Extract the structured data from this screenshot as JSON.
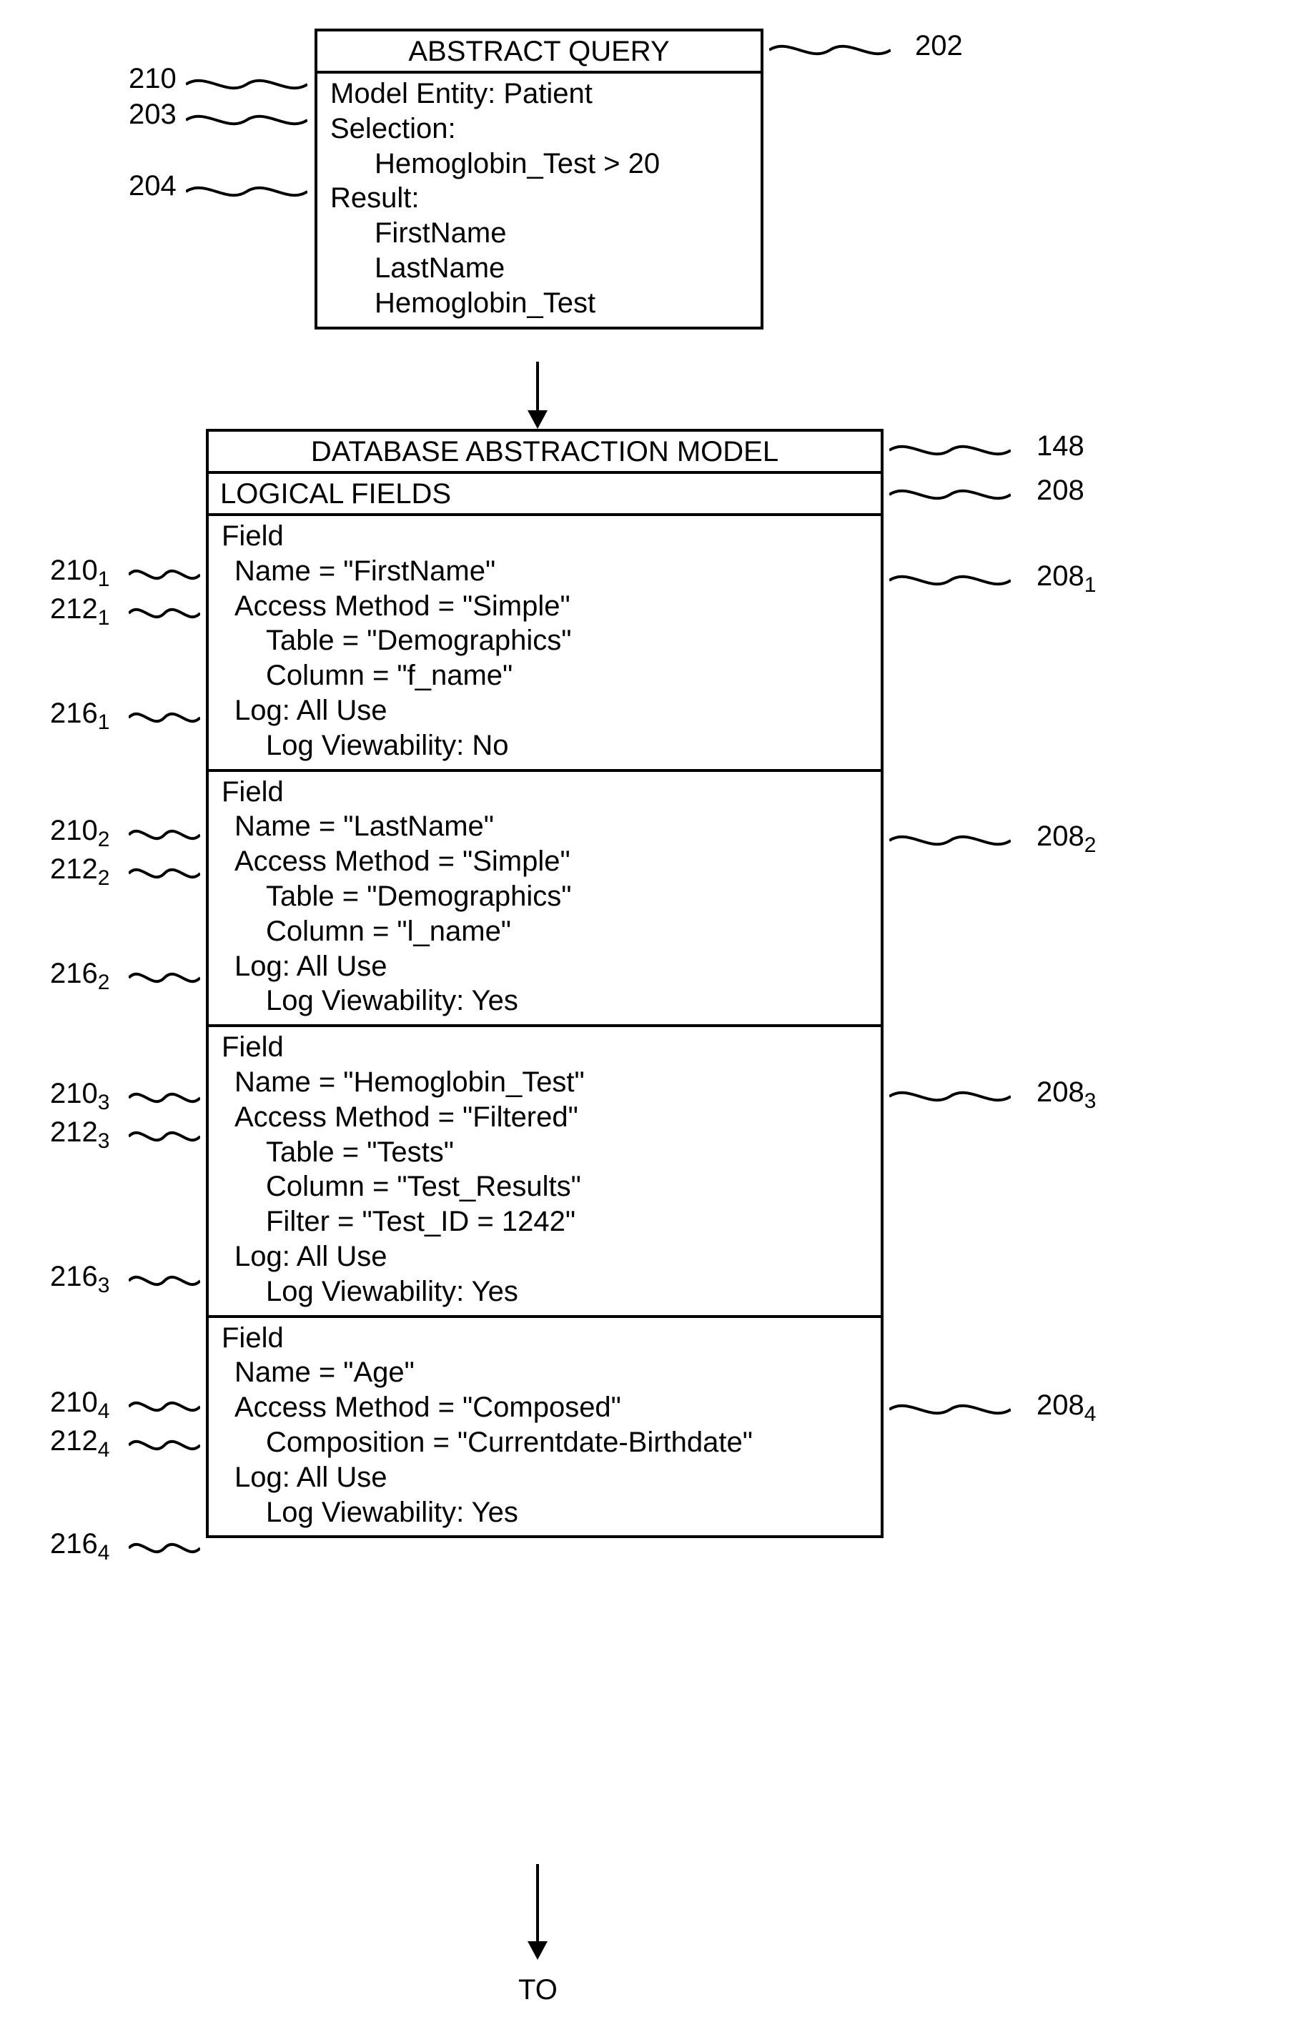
{
  "abstractQuery": {
    "title": "ABSTRACT QUERY",
    "modelEntity": "Model Entity: Patient",
    "selectionLabel": "Selection:",
    "selectionCond": "Hemoglobin_Test > 20",
    "resultLabel": "Result:",
    "result1": "FirstName",
    "result2": "LastName",
    "result3": "Hemoglobin_Test"
  },
  "dam": {
    "title": "DATABASE ABSTRACTION MODEL",
    "logicalFields": "LOGICAL FIELDS",
    "fields": [
      {
        "heading": "Field",
        "name": "Name = \"FirstName\"",
        "access": "Access Method = \"Simple\"",
        "table": "Table = \"Demographics\"",
        "column": "Column = \"f_name\"",
        "log": "Log: All Use",
        "logv": "Log Viewability: No"
      },
      {
        "heading": "Field",
        "name": "Name = \"LastName\"",
        "access": "Access Method = \"Simple\"",
        "table": "Table = \"Demographics\"",
        "column": "Column = \"l_name\"",
        "log": "Log: All Use",
        "logv": "Log Viewability: Yes"
      },
      {
        "heading": "Field",
        "name": "Name = \"Hemoglobin_Test\"",
        "access": "Access Method = \"Filtered\"",
        "table": "Table = \"Tests\"",
        "column": "Column = \"Test_Results\"",
        "filter": "Filter = \"Test_ID = 1242\"",
        "log": "Log: All Use",
        "logv": "Log Viewability: Yes"
      },
      {
        "heading": "Field",
        "name": "Name = \"Age\"",
        "access": "Access Method = \"Composed\"",
        "composition": "Composition = \"Currentdate-Birthdate\"",
        "log": "Log: All Use",
        "logv": "Log Viewability: Yes"
      }
    ]
  },
  "refs": {
    "r202": "202",
    "r210": "210",
    "r203": "203",
    "r204": "204",
    "r148": "148",
    "r208": "208",
    "r210s": "210",
    "r212s": "212",
    "r216s": "216",
    "r208s": "208",
    "sub1": "1",
    "sub2": "2",
    "sub3": "3",
    "sub4": "4"
  },
  "to": "TO"
}
